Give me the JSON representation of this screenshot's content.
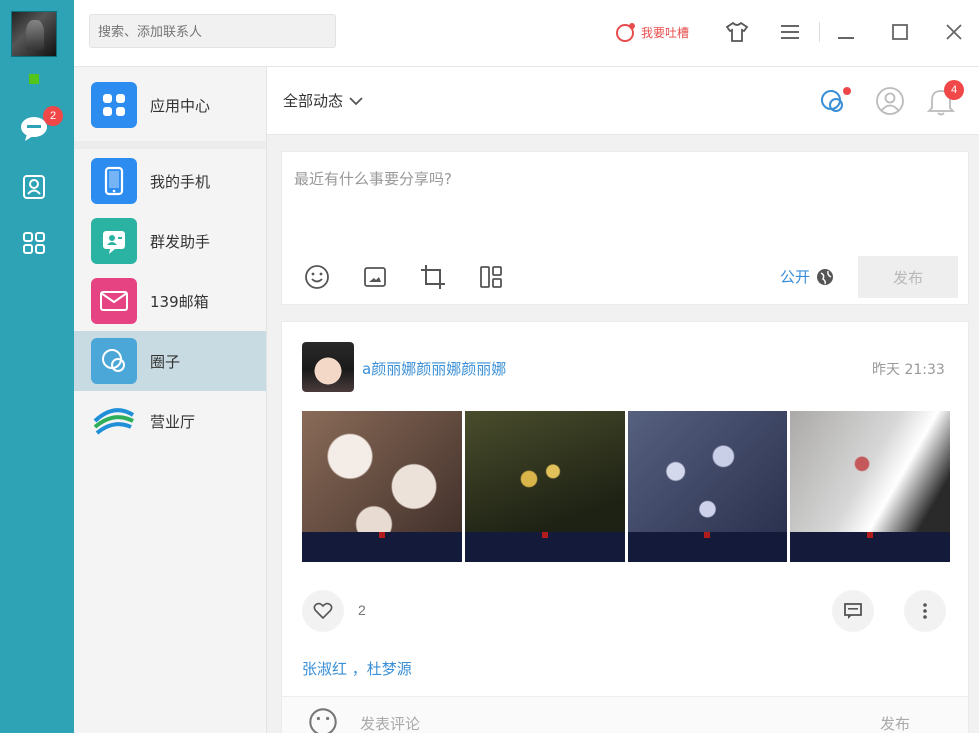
{
  "window": {
    "search_placeholder": "搜索、添加联系人",
    "feedback_label": "我要吐槽"
  },
  "rail": {
    "message_badge": "2"
  },
  "nav": {
    "items": [
      {
        "label": "应用中心",
        "color": "#2d8cf0"
      },
      {
        "label": "我的手机",
        "color": "#2d8cf0"
      },
      {
        "label": "群发助手",
        "color": "#2ab3a3"
      },
      {
        "label": "139邮箱",
        "color": "#e64383"
      },
      {
        "label": "圈子",
        "color": "#4aa7d8"
      },
      {
        "label": "营业厅",
        "color": "#2d8cf0"
      }
    ]
  },
  "main": {
    "filter_label": "全部动态",
    "notification_badge": "4",
    "composer": {
      "placeholder": "最近有什么事要分享吗?",
      "visibility": "公开",
      "publish_label": "发布"
    },
    "post": {
      "author": "a颜丽娜颜丽娜颜丽娜",
      "time": "昨天 21:33",
      "like_count": "2",
      "likers": "张淑红 ，杜梦源",
      "comment_placeholder": "发表评论",
      "comment_send": "发布"
    }
  },
  "colors": {
    "rail": "#2ea3b5",
    "accent": "#3a8fd6",
    "badge": "#f04848"
  }
}
